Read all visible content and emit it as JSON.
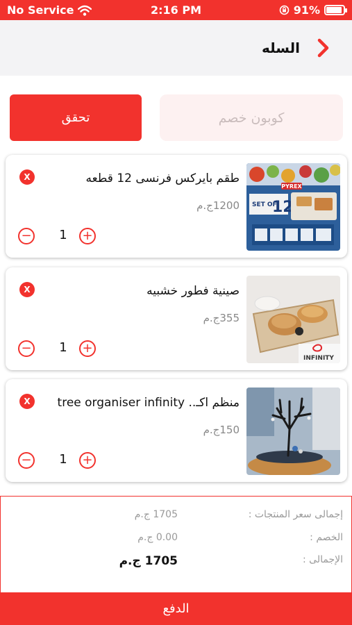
{
  "status_bar": {
    "carrier": "No Service",
    "time": "2:16 PM",
    "battery": "91%",
    "battery_level": 0.91
  },
  "header": {
    "title": "السله"
  },
  "coupon": {
    "placeholder": "كوبون خصم",
    "verify_label": "تحقق"
  },
  "cart_items": [
    {
      "name": "طقم بايركس فرنسى 12 قطعه",
      "price": "1200ج.م",
      "quantity": "1"
    },
    {
      "name": "صينية فطور خشبيه",
      "price": "355ج.م",
      "quantity": "1"
    },
    {
      "name": "منظم اكـ.. tree organiser infinity",
      "price": "150ج.م",
      "quantity": "1"
    }
  ],
  "summary": {
    "subtotal_label": "إجمالى سعر المنتجات :",
    "subtotal_value": "1705 ج.م",
    "discount_label": "الخصم :",
    "discount_value": "0.00 ج.م",
    "total_label": "الإجمالى :",
    "total_value": "1705 ج.م"
  },
  "pay_button": {
    "label": "الدفع"
  },
  "thumb_badges": {
    "pyrex": "PYREX",
    "set_of": "SET OF",
    "set_count": "12",
    "infinity": "INFINITY"
  },
  "colors": {
    "accent": "#f2322d",
    "header_bg": "#f3f3f5",
    "coupon_bg": "#fdf1f1"
  }
}
